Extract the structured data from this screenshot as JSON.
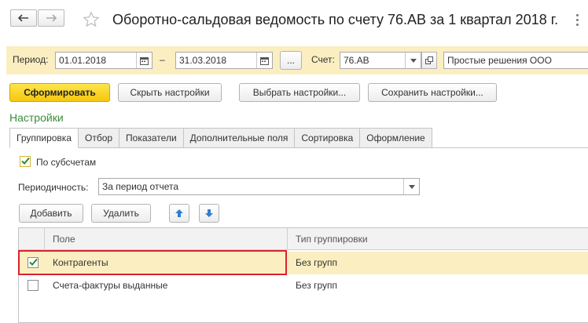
{
  "header": {
    "title": "Оборотно-сальдовая ведомость по счету 76.АВ за 1 квартал 2018 г."
  },
  "params": {
    "period_label": "Период:",
    "period_from": "01.01.2018",
    "period_dash": "–",
    "period_to": "31.03.2018",
    "ellipsis_label": "...",
    "account_label": "Счет:",
    "account_value": "76.АВ",
    "organization_value": "Простые решения ООО"
  },
  "toolbar": {
    "generate_label": "Сформировать",
    "hide_settings_label": "Скрыть настройки",
    "choose_settings_label": "Выбрать настройки...",
    "save_settings_label": "Сохранить настройки..."
  },
  "settings": {
    "title": "Настройки",
    "tabs": [
      {
        "label": "Группировка"
      },
      {
        "label": "Отбор"
      },
      {
        "label": "Показатели"
      },
      {
        "label": "Дополнительные поля"
      },
      {
        "label": "Сортировка"
      },
      {
        "label": "Оформление"
      }
    ],
    "by_subaccounts_label": "По субсчетам",
    "periodicity_label": "Периодичность:",
    "periodicity_value": "За период отчета",
    "add_label": "Добавить",
    "delete_label": "Удалить"
  },
  "table": {
    "columns": [
      "Поле",
      "Тип группировки"
    ],
    "rows": [
      {
        "field": "Контрагенты",
        "grouping": "Без групп",
        "checked": true
      },
      {
        "field": "Счета-фактуры выданные",
        "grouping": "Без групп",
        "checked": false
      }
    ]
  },
  "colors": {
    "accent_yellow": "#f5c80e",
    "panel_yellow": "#fbeec0",
    "section_green": "#3a8d3a",
    "highlight_red": "#d9232e",
    "arrow_blue": "#2f7fd3"
  }
}
